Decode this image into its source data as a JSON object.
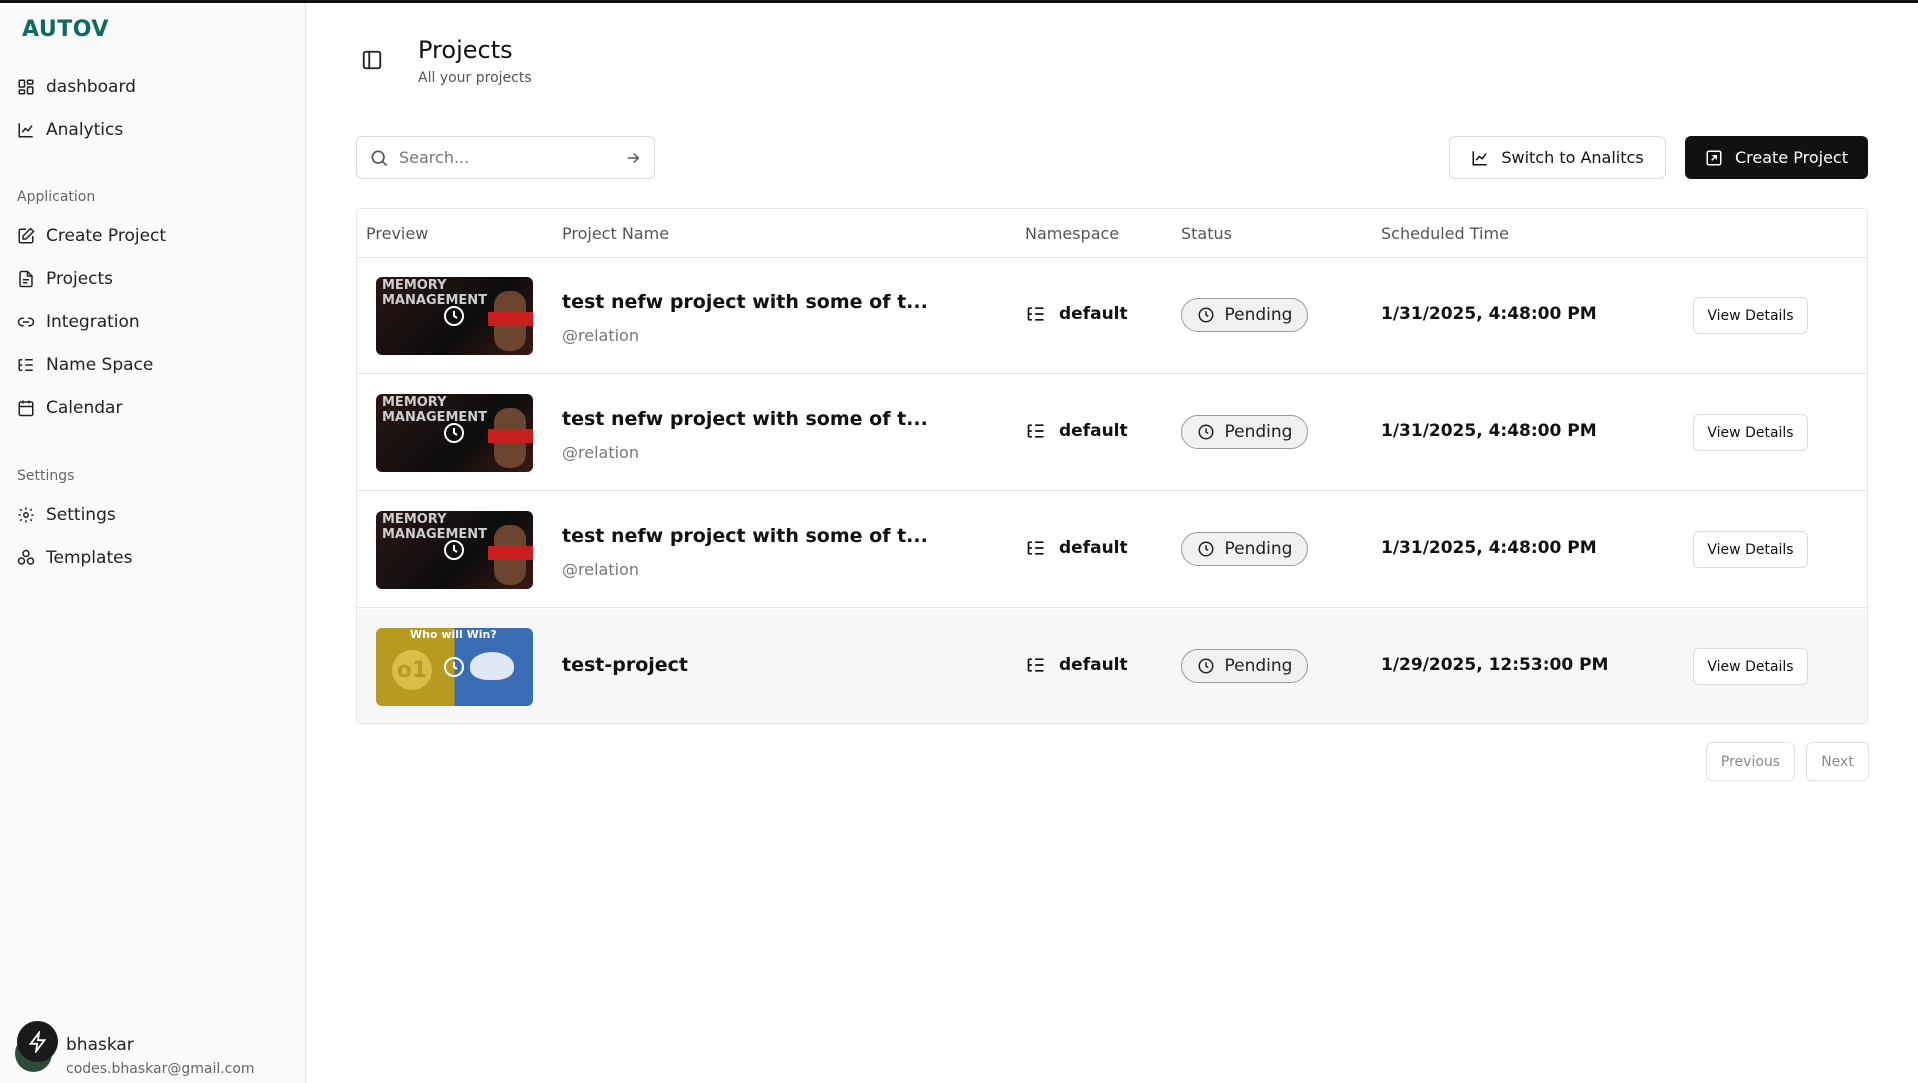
{
  "sidebar": {
    "logo": "AUTOV",
    "top_items": [
      {
        "label": "dashboard",
        "icon": "dashboard-grid-icon"
      },
      {
        "label": "Analytics",
        "icon": "line-chart-icon"
      }
    ],
    "groups": [
      {
        "label": "Application",
        "items": [
          {
            "label": "Create Project",
            "icon": "edit-icon"
          },
          {
            "label": "Projects",
            "icon": "file-icon"
          },
          {
            "label": "Integration",
            "icon": "link-icon"
          },
          {
            "label": "Name Space",
            "icon": "list-tree-icon"
          },
          {
            "label": "Calendar",
            "icon": "calendar-icon"
          }
        ]
      },
      {
        "label": "Settings",
        "items": [
          {
            "label": "Settings",
            "icon": "gear-icon"
          },
          {
            "label": "Templates",
            "icon": "templates-icon"
          }
        ]
      }
    ],
    "user": {
      "name": "bhaskar",
      "email": "codes.bhaskar@gmail.com"
    }
  },
  "header": {
    "title": "Projects",
    "subtitle": "All your projects"
  },
  "toolbar": {
    "search_placeholder": "Search...",
    "switch_label": "Switch to Analitcs",
    "create_label": "Create Project"
  },
  "table": {
    "columns": [
      "Preview",
      "Project Name",
      "Namespace",
      "Status",
      "Scheduled Time"
    ],
    "rows": [
      {
        "thumb_text": "MEMORY MANAGEMENT",
        "name": "test nefw project with some of t...",
        "relation": "@relation",
        "namespace": "default",
        "status": "Pending",
        "scheduled": "1/31/2025, 4:48:00 PM",
        "action": "View Details"
      },
      {
        "thumb_text": "MEMORY MANAGEMENT",
        "name": "test nefw project with some of t...",
        "relation": "@relation",
        "namespace": "default",
        "status": "Pending",
        "scheduled": "1/31/2025, 4:48:00 PM",
        "action": "View Details"
      },
      {
        "thumb_text": "MEMORY MANAGEMENT",
        "name": "test nefw project with some of t...",
        "relation": "@relation",
        "namespace": "default",
        "status": "Pending",
        "scheduled": "1/31/2025, 4:48:00 PM",
        "action": "View Details"
      },
      {
        "thumb_text": "Who will Win?",
        "name": "test-project",
        "relation": "",
        "namespace": "default",
        "status": "Pending",
        "scheduled": "1/29/2025, 12:53:00 PM",
        "action": "View Details"
      }
    ]
  },
  "pagination": {
    "previous": "Previous",
    "next": "Next"
  },
  "colors": {
    "brand": "#0f6b5c",
    "primary_button": "#111111"
  }
}
